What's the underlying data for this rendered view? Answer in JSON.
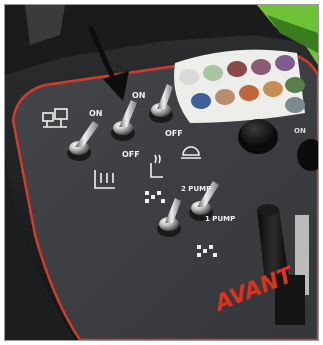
{
  "scene": {
    "description_free": true,
    "colors": {
      "panel": "#3b3d41",
      "panel_trim": "#d23a2a",
      "housing": "#1c1d1f",
      "accent_green": "#7ad03a",
      "label_white": "#f2f2f2",
      "brand_red": "#e0301e",
      "arrow": "#0d0d0d"
    },
    "switch_labels": {
      "left_on": "ON",
      "mid_on": "ON",
      "mid_off": "OFF",
      "right_off": "OFF"
    },
    "pump_labels": {
      "two_pump": "2 PUMP",
      "one_pump": "1 PUMP"
    },
    "brand": "AVANT",
    "indicator_lights": [
      "#d9d9d9",
      "#a7c7a3",
      "#8a4a4a",
      "#8d5a74",
      "#7e5d8e",
      "#3d5f9a",
      "#b88c6e",
      "#c0653a",
      "#c68d54",
      "#5a7e4a",
      "#7c8b92"
    ],
    "icons": [
      "arrow-pointer-icon",
      "hydraulic-valve-icon",
      "seat-heater-icon",
      "beacon-light-icon",
      "auxiliary-hydraulics-icon",
      "float-position-icon"
    ]
  }
}
